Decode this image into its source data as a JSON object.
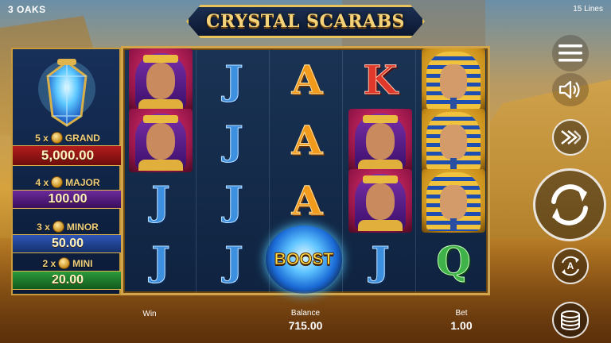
{
  "header": {
    "provider": "3 OAKS",
    "lines": "15 Lines",
    "game_title": "CRYSTAL SCARABS"
  },
  "jackpots": [
    {
      "multiplier": "5 x",
      "name": "GRAND",
      "value": "5,000.00",
      "color": "#b41d1d"
    },
    {
      "multiplier": "4 x",
      "name": "MAJOR",
      "value": "100.00",
      "color": "#6b2a9a"
    },
    {
      "multiplier": "3 x",
      "name": "MINOR",
      "value": "50.00",
      "color": "#2f56b8"
    },
    {
      "multiplier": "2 x",
      "name": "MINI",
      "value": "20.00",
      "color": "#2b9a3a"
    }
  ],
  "reels": [
    [
      "queen",
      "queen",
      "J",
      "J"
    ],
    [
      "J",
      "J",
      "J",
      "J"
    ],
    [
      "A",
      "A",
      "A",
      "boost"
    ],
    [
      "K",
      "queen",
      "queen",
      "J"
    ],
    [
      "pharaoh",
      "pharaoh",
      "pharaoh",
      "Q"
    ]
  ],
  "boost": {
    "label": "BOOST"
  },
  "footer": {
    "win_label": "Win",
    "balance_label": "Balance",
    "balance_value": "715.00",
    "bet_label": "Bet",
    "bet_value": "1.00"
  },
  "controls": {
    "icons": [
      "menu-icon",
      "sound-icon",
      "turbo-icon",
      "spin-icon",
      "autoplay-icon",
      "bet-coins-icon"
    ],
    "autoplay_letter": "A"
  }
}
